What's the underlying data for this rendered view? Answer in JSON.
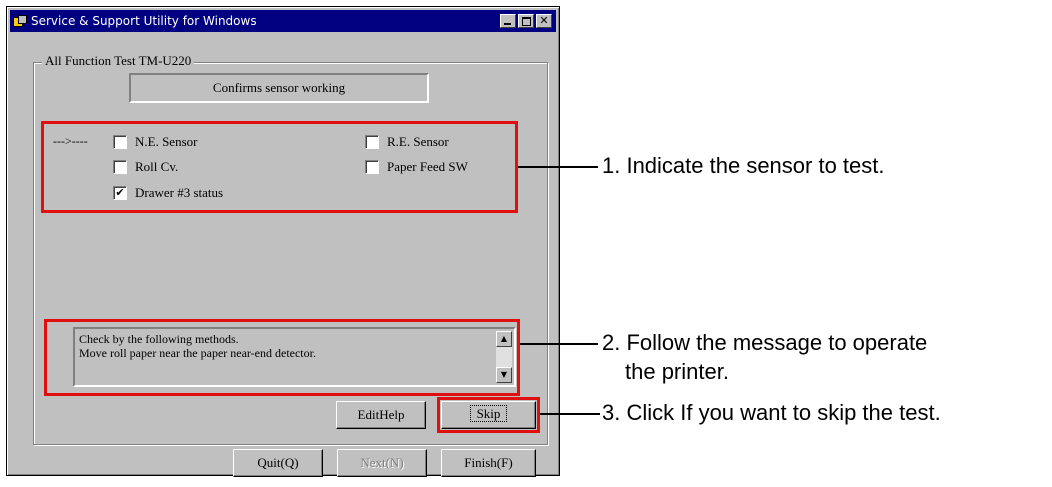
{
  "window": {
    "title": "Service & Support Utility for Windows"
  },
  "group": {
    "label": "All Function Test TM-U220",
    "confirm_text": "Confirms sensor working"
  },
  "indicator": "--->----",
  "sensors": {
    "ne_sensor": {
      "label": "N.E. Sensor",
      "checked": false
    },
    "re_sensor": {
      "label": "R.E. Sensor",
      "checked": false
    },
    "roll_cv": {
      "label": "Roll Cv.",
      "checked": false
    },
    "paper_feed_sw": {
      "label": "Paper Feed SW",
      "checked": false
    },
    "drawer3": {
      "label": "Drawer #3 status",
      "checked": true,
      "mark": "✔"
    }
  },
  "message": {
    "line1": "Check by the following methods.",
    "line2": "Move roll paper near the paper near-end detector."
  },
  "buttons": {
    "edit_help": "EditHelp",
    "skip": "Skip",
    "quit": "Quit(Q)",
    "next": "Next(N)",
    "finish": "Finish(F)"
  },
  "annotations": {
    "a1": "1. Indicate the sensor to test.",
    "a2_line1": "2. Follow the message to operate",
    "a2_line2": "the printer.",
    "a3": "3. Click If you want to skip the test."
  },
  "colors": {
    "highlight": "#e01010",
    "titlebar": "#000080",
    "face": "#c0c0c0"
  }
}
